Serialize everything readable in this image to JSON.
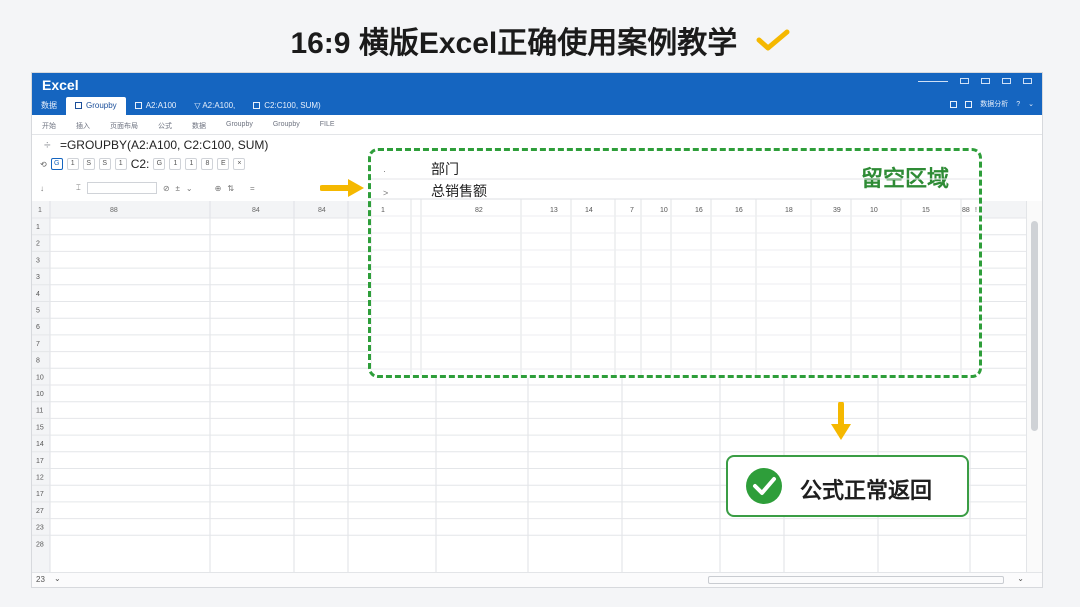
{
  "page_title": "16:9 横版Excel正确使用案例教学",
  "window": {
    "app_name": "Excel",
    "tabs": [
      "数据",
      "Groupby",
      "A2:A100",
      "A2:A100,",
      "C2:C100,  SUM)"
    ],
    "right_tools": "数据分析"
  },
  "ribbon_menu": [
    "开始",
    "插入",
    "页面布局",
    "公式",
    "数据",
    "Groupby",
    "Groupby",
    "FILE"
  ],
  "formula_bar": {
    "fx": "÷",
    "formula": "=GROUPBY(A2:A100, C2:C100, SUM)"
  },
  "toolbar1": {
    "buttons": [
      "1",
      "S",
      "S",
      "1",
      "C2:",
      "G",
      "1",
      "1",
      "8",
      "E",
      "×"
    ]
  },
  "grid": {
    "col_headers_left": [
      "1",
      "88",
      "84",
      "84"
    ],
    "col_headers_right": [
      "1",
      "82",
      "13",
      "14",
      "7",
      "10",
      "16",
      "16",
      "18",
      "39",
      "10",
      "15",
      "88",
      "!"
    ],
    "row_headers": [
      "1",
      "2",
      "3",
      "3",
      "4",
      "5",
      "6",
      "7",
      "8",
      "10",
      "10",
      "11",
      "15",
      "14",
      "17",
      "12",
      "17",
      "27",
      "23",
      "28"
    ],
    "sheet_num": "23"
  },
  "overlay": {
    "zone_label": "留空区域",
    "row1_label": "部门",
    "row2_label": "总销售额",
    "row1_mini": "·",
    "row2_mini": ">"
  },
  "result_badge": {
    "label": "公式正常返回"
  },
  "colors": {
    "accent_blue": "#1565c0",
    "dashed_green": "#2e9e3a",
    "arrow_yellow": "#f5b800"
  }
}
